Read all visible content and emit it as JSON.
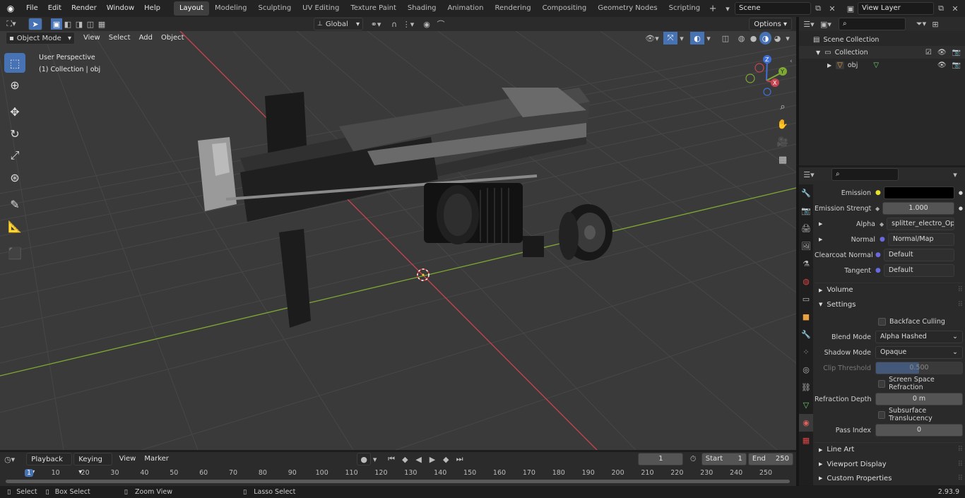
{
  "app": {
    "version": "2.93.9"
  },
  "topbar": {
    "menus": [
      "File",
      "Edit",
      "Render",
      "Window",
      "Help"
    ],
    "workspaces": [
      "Layout",
      "Modeling",
      "Sculpting",
      "UV Editing",
      "Texture Paint",
      "Shading",
      "Animation",
      "Rendering",
      "Compositing",
      "Geometry Nodes",
      "Scripting"
    ],
    "active_workspace": "Layout",
    "scene": "Scene",
    "view_layer": "View Layer"
  },
  "viewport": {
    "mode": "Object Mode",
    "menus": [
      "View",
      "Select",
      "Add",
      "Object"
    ],
    "transform_orientation": "Global",
    "options_label": "Options",
    "overlay_line1": "User Perspective",
    "overlay_line2": "(1) Collection | obj",
    "gizmo": {
      "z": "Z",
      "y": "Y",
      "x": "X"
    }
  },
  "outliner": {
    "search_placeholder": "",
    "scene_collection": "Scene Collection",
    "collection": "Collection",
    "object": "obj"
  },
  "properties": {
    "rows": {
      "emission": {
        "label": "Emission",
        "value": ""
      },
      "emission_strength": {
        "label": "Emission Strengt",
        "value": "1.000"
      },
      "alpha": {
        "label": "Alpha",
        "value": "splitter_electro_Opa..."
      },
      "normal": {
        "label": "Normal",
        "value": "Normal/Map"
      },
      "clearcoat_normal": {
        "label": "Clearcoat Normal",
        "value": "Default"
      },
      "tangent": {
        "label": "Tangent",
        "value": "Default"
      }
    },
    "panels": {
      "volume": "Volume",
      "settings": "Settings",
      "line_art": "Line Art",
      "viewport_display": "Viewport Display",
      "custom_properties": "Custom Properties"
    },
    "settings": {
      "backface_culling": "Backface Culling",
      "blend_mode_label": "Blend Mode",
      "blend_mode": "Alpha Hashed",
      "shadow_mode_label": "Shadow Mode",
      "shadow_mode": "Opaque",
      "clip_threshold_label": "Clip Threshold",
      "clip_threshold": "0.500",
      "clip_threshold_fill": 0.5,
      "ssr": "Screen Space Refraction",
      "refraction_depth_label": "Refraction Depth",
      "refraction_depth": "0 m",
      "subsurface": "Subsurface Translucency",
      "pass_index_label": "Pass Index",
      "pass_index": "0"
    }
  },
  "timeline": {
    "menus": [
      "Playback",
      "Keying",
      "View",
      "Marker"
    ],
    "current_frame": "1",
    "start_label": "Start",
    "start": "1",
    "end_label": "End",
    "end": "250",
    "ticks": [
      "1",
      "10",
      "20",
      "30",
      "40",
      "50",
      "60",
      "70",
      "80",
      "90",
      "100",
      "110",
      "120",
      "130",
      "140",
      "150",
      "160",
      "170",
      "180",
      "190",
      "200",
      "210",
      "220",
      "230",
      "240",
      "250"
    ]
  },
  "statusbar": {
    "select": "Select",
    "box_select": "Box Select",
    "zoom_view": "Zoom View",
    "lasso_select": "Lasso Select"
  },
  "colors": {
    "accent": "#4772b3",
    "x_axis": "#c94450",
    "y_axis": "#7fa832",
    "z_axis": "#3f6fd6"
  }
}
